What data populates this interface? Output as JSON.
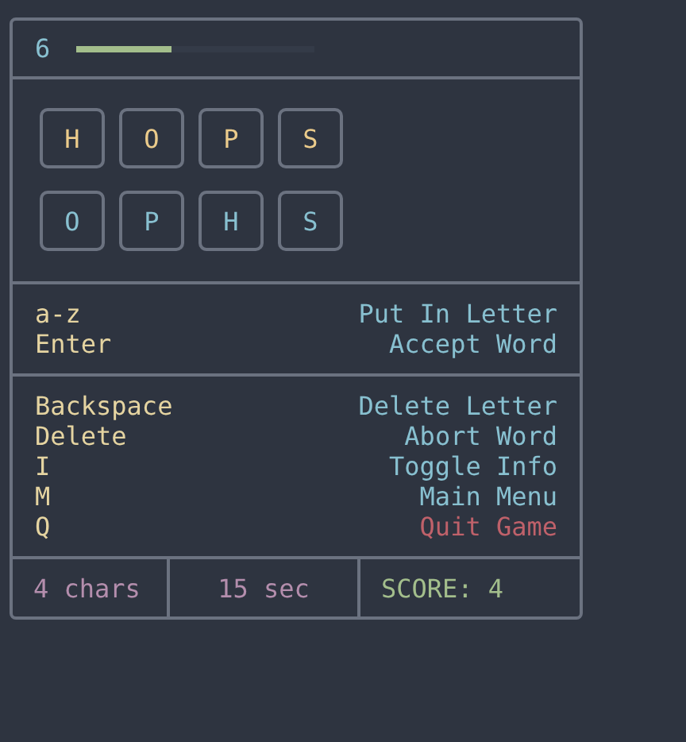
{
  "header": {
    "count": "6",
    "timer": {
      "level": 0.4
    }
  },
  "tile_rows": [
    {
      "kind": "typed",
      "tiles": [
        "H",
        "O",
        "P",
        "S"
      ]
    },
    {
      "kind": "target",
      "tiles": [
        "O",
        "P",
        "H",
        "S"
      ]
    }
  ],
  "key_groups": [
    [
      {
        "key": "a-z",
        "action": "Put In Letter",
        "kind": "normal"
      },
      {
        "key": "Enter",
        "action": "Accept Word",
        "kind": "normal"
      }
    ],
    [
      {
        "key": "Backspace",
        "action": "Delete Letter",
        "kind": "normal"
      },
      {
        "key": "Delete",
        "action": "Abort Word",
        "kind": "normal"
      },
      {
        "key": "I",
        "action": "Toggle Info",
        "kind": "normal"
      },
      {
        "key": "M",
        "action": "Main Menu",
        "kind": "normal"
      },
      {
        "key": "Q",
        "action": "Quit Game",
        "kind": "danger"
      }
    ]
  ],
  "status_bar": {
    "chars": "4 chars",
    "time": "15 sec",
    "score": "SCORE: 4"
  }
}
